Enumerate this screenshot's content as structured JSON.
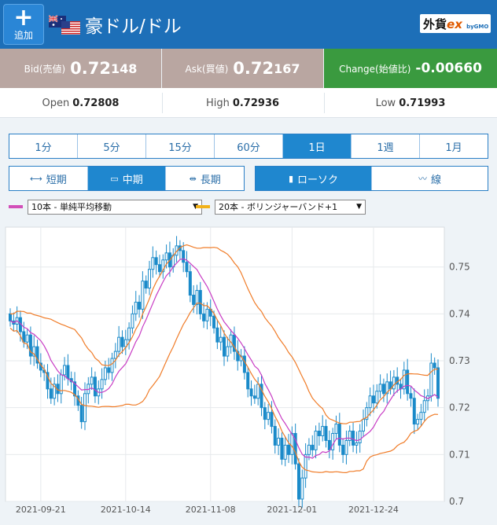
{
  "header": {
    "add_label": "追加",
    "add_icon": "+",
    "pair_title": "豪ドル/ドル",
    "logo_main": "外貨",
    "logo_ex": "ex",
    "logo_gmo": "byGMO"
  },
  "quotes": {
    "bid_label": "Bid(売値)",
    "bid_main": "0.72",
    "bid_sub": "148",
    "ask_label": "Ask(買値)",
    "ask_main": "0.72",
    "ask_sub": "167",
    "change_label": "Change(始値比)",
    "change_value": "-0.00660"
  },
  "ohl": {
    "open_label": "Open",
    "open_value": "0.72808",
    "high_label": "High",
    "high_value": "0.72936",
    "low_label": "Low",
    "low_value": "0.71993"
  },
  "period_tabs": [
    "1分",
    "5分",
    "15分",
    "60分",
    "1日",
    "1週",
    "1月"
  ],
  "active_period": 4,
  "term_buttons": [
    {
      "icon": "⟷",
      "label": "短期"
    },
    {
      "icon": "▭",
      "label": "中期"
    },
    {
      "icon": "⇹",
      "label": "長期"
    }
  ],
  "active_term": 1,
  "chart_type_buttons": [
    {
      "icon": "▮",
      "label": "ローソク"
    },
    {
      "icon": "〰",
      "label": "線"
    }
  ],
  "active_chart_type": 0,
  "indicators": [
    {
      "label": "10本 - 単純平均移動",
      "color": "#d24fb9"
    },
    {
      "label": "20本 - ボリンジャーバンド+1",
      "color": "#f2b21a"
    }
  ],
  "colors": {
    "candle": "#1a8ac9",
    "sma": "#c83cc4",
    "bollinger": "#f07c28"
  },
  "chart_data": {
    "type": "candlestick",
    "x_ticks": [
      "2021-09-21",
      "2021-10-14",
      "2021-11-08",
      "2021-12-01",
      "2021-12-24"
    ],
    "y_ticks": [
      0.75,
      0.74,
      0.73,
      0.72,
      0.71,
      0.7
    ],
    "ylim": [
      0.7,
      0.7585
    ],
    "grid": true,
    "close": [
      0.7385,
      0.7378,
      0.7392,
      0.7362,
      0.734,
      0.7355,
      0.731,
      0.733,
      0.7295,
      0.728,
      0.7275,
      0.724,
      0.722,
      0.725,
      0.723,
      0.727,
      0.729,
      0.7262,
      0.7255,
      0.7225,
      0.7205,
      0.717,
      0.723,
      0.725,
      0.7265,
      0.7225,
      0.724,
      0.726,
      0.7285,
      0.7275,
      0.7305,
      0.732,
      0.735,
      0.733,
      0.7345,
      0.737,
      0.74,
      0.7425,
      0.741,
      0.747,
      0.7455,
      0.7495,
      0.752,
      0.7505,
      0.749,
      0.7515,
      0.753,
      0.75,
      0.7525,
      0.7545,
      0.7535,
      0.751,
      0.749,
      0.744,
      0.742,
      0.745,
      0.74,
      0.7385,
      0.741,
      0.7395,
      0.737,
      0.734,
      0.735,
      0.731,
      0.733,
      0.7355,
      0.732,
      0.73,
      0.731,
      0.7275,
      0.724,
      0.7225,
      0.722,
      0.725,
      0.72,
      0.7175,
      0.719,
      0.716,
      0.712,
      0.7135,
      0.709,
      0.712,
      0.71,
      0.7145,
      0.708,
      0.7005,
      0.705,
      0.71,
      0.712,
      0.711,
      0.715,
      0.714,
      0.716,
      0.713,
      0.711,
      0.7145,
      0.7165,
      0.712,
      0.71,
      0.713,
      0.715,
      0.712,
      0.7125,
      0.715,
      0.7175,
      0.72,
      0.7225,
      0.721,
      0.7235,
      0.725,
      0.723,
      0.7255,
      0.724,
      0.7265,
      0.725,
      0.724,
      0.728,
      0.723,
      0.722,
      0.7165,
      0.7175,
      0.719,
      0.7215,
      0.7225,
      0.7295,
      0.7285,
      0.722
    ]
  }
}
